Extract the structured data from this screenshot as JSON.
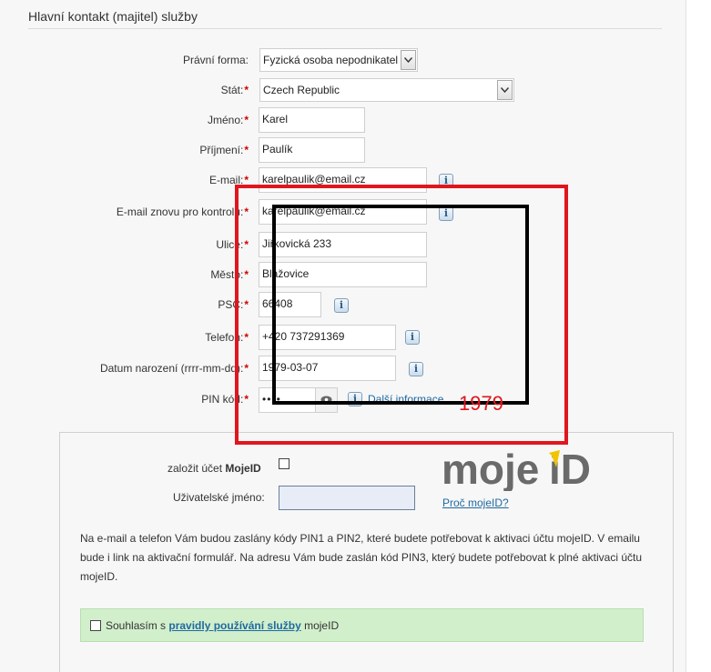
{
  "section": {
    "title": "Hlavní kontakt (majitel) služby"
  },
  "form": {
    "legal_form": {
      "label": "Právní forma:",
      "value": "Fyzická osoba nepodnikatel"
    },
    "country": {
      "label": "Stát:",
      "value": "Czech Republic"
    },
    "first_name": {
      "label": "Jméno:",
      "value": "Karel"
    },
    "last_name": {
      "label": "Příjmení:",
      "value": "Paulík"
    },
    "email": {
      "label": "E-mail:",
      "value": "karelpaulik@email.cz"
    },
    "email_confirm": {
      "label": "E-mail znovu pro kontrolu:",
      "value": "karelpaulik@email.cz"
    },
    "street": {
      "label": "Ulice:",
      "value": "Jiřkovická 233"
    },
    "city": {
      "label": "Město:",
      "value": "Blažovice"
    },
    "zip": {
      "label": "PSČ:",
      "value": "66408"
    },
    "phone": {
      "label": "Telefon:",
      "value": "+420 737291369"
    },
    "birth_date": {
      "label": "Datum narození (rrrr-mm-dd):",
      "value": "1979-03-07"
    },
    "pin": {
      "label": "PIN kód:",
      "value": "••••",
      "more_info": "Další informace"
    },
    "required_mark": "*",
    "info_glyph": "i"
  },
  "mojeid": {
    "create_account_label": "založit účet",
    "create_account_brand": "MojeID",
    "create_account_checked": false,
    "username_label": "Uživatelské jméno:",
    "username_value": "",
    "logo_text_main": "moje",
    "logo_text_accent": "iD",
    "why_link": "Proč mojeID?",
    "note": "Na e-mail a telefon Vám budou zaslány kódy PIN1 a PIN2, které budete potřebovat k aktivaci účtu mojeID. V emailu bude i link na aktivační formulář. Na adresu Vám bude zaslán kód PIN3, který budete potřebovat k plné aktivaci účtu mojeID.",
    "agree_prefix": "Souhlasím s",
    "agree_link": "pravidly používání služby",
    "agree_suffix": "mojeID",
    "agree_checked": false,
    "colors": {
      "logo_grey": "#6a6a6a",
      "logo_yellow": "#f2c400",
      "agree_bg": "#d2efcc"
    }
  },
  "annotation": {
    "number": "1979",
    "colors": {
      "red": "#e0161e",
      "black": "#000000"
    }
  }
}
